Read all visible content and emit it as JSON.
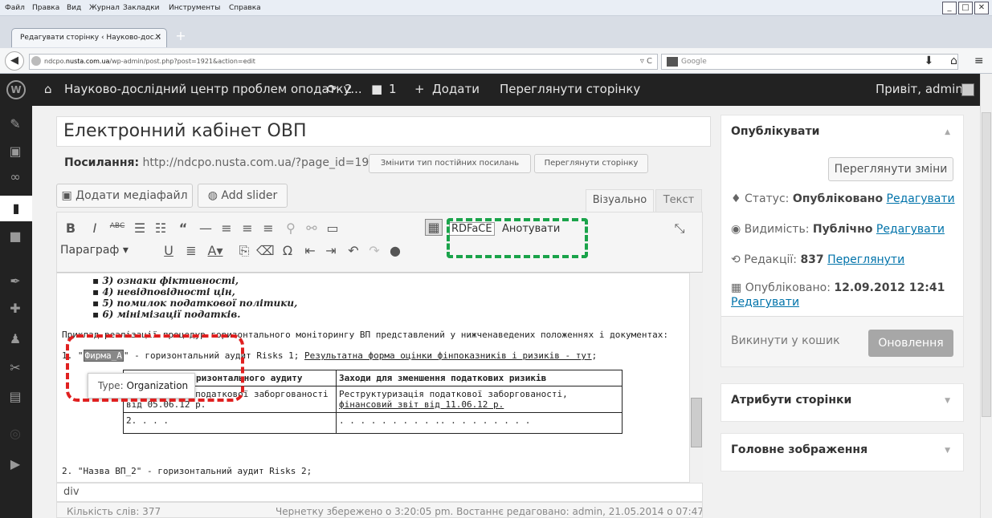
{
  "menubar": [
    "Файл",
    "Правка",
    "Вид",
    "Журнал",
    "Закладки",
    "Инструменты",
    "Справка"
  ],
  "browser": {
    "tab_title": "Редагувати сторінку ‹ Науково-дос...",
    "url_prefix": "ndcpo.",
    "url_host": "nusta.com.ua",
    "url_path": "/wp-admin/post.php?post=1921&action=edit",
    "search_placeholder": "Google"
  },
  "adminbar": {
    "site": "Науково-дослідний центр проблем оподатку...",
    "updates": "2",
    "comments": "1",
    "add": "Додати",
    "view": "Переглянути сторінку",
    "greeting": "Привіт, admin"
  },
  "post": {
    "title": "Електронний кабінет ОВП",
    "permalink_label": "Посилання:",
    "permalink_url": "http://ndcpo.nusta.com.ua/?page_id=1921",
    "change_permalink": "Змінити тип постійних посилань",
    "view_page": "Переглянути сторінку"
  },
  "editor": {
    "add_media": "Додати медіафайл",
    "add_slider": "Add slider",
    "tab_visual": "Візуально",
    "tab_text": "Текст",
    "format": "Параграф",
    "rdfa": "RDFaCE",
    "annotate": "Анотувати",
    "bullets": [
      "3) ознаки фіктивності,",
      "4) невідповідності цін,",
      "5) помилок податкової політики,",
      "6) мінімізації податків."
    ],
    "para": "Приклад реалізації процедур горизонтального моніторингу ВП представлений у нижченаведених положеннях і документах:",
    "item1_num": "1. \"",
    "entity": "Фирма_А",
    "item1_rest": "\" - горизонтальний аудит Risks 1;",
    "item1_link": "Результатна форма оцінки фінпоказників і ризиків - тут",
    "tooltip_label": "Type:",
    "tooltip_value": "Organization",
    "table_header": [
      "ризонтального аудиту",
      "Заходи для зменшення податкових ризиків"
    ],
    "row1": [
      "1. Наявність податкової заборгованості від 05.06.12 р.",
      "Реструктуризація податкової заборгованості,",
      "фінансовий звіт від 11.06.12 р."
    ],
    "row2": [
      "2. . . .",
      ". . . . . . . . . .. . . . . . . . ."
    ],
    "item2": "2. \"Назва ВП_2\" - горизонтальний аудит Risks 2;",
    "path": "div",
    "word_count": "Кількість слів: 377",
    "autosave": "Чернетку збережено о 3:20:05 pm. Востаннє редаговано: admin, 21.05.2014 о 07:47"
  },
  "publish": {
    "title": "Опублікувати",
    "preview": "Переглянути зміни",
    "status_label": "Статус:",
    "status_value": "Опубліковано",
    "edit": "Редагувати",
    "visibility_label": "Видимість:",
    "visibility_value": "Публічно",
    "revisions_label": "Редакції:",
    "revisions_value": "837",
    "revisions_link": "Переглянути",
    "published_label": "Опубліковано:",
    "published_value": "12.09.2012 12:41",
    "trash": "Викинути у кошик",
    "update": "Оновлення"
  },
  "attributes": {
    "title": "Атрибути сторінки"
  },
  "featured": {
    "title": "Головне зображення"
  },
  "colors": {
    "adminbar": "#222222",
    "accent_red": "#e02020",
    "accent_green": "#1aa34a",
    "link": "#0073aa"
  }
}
